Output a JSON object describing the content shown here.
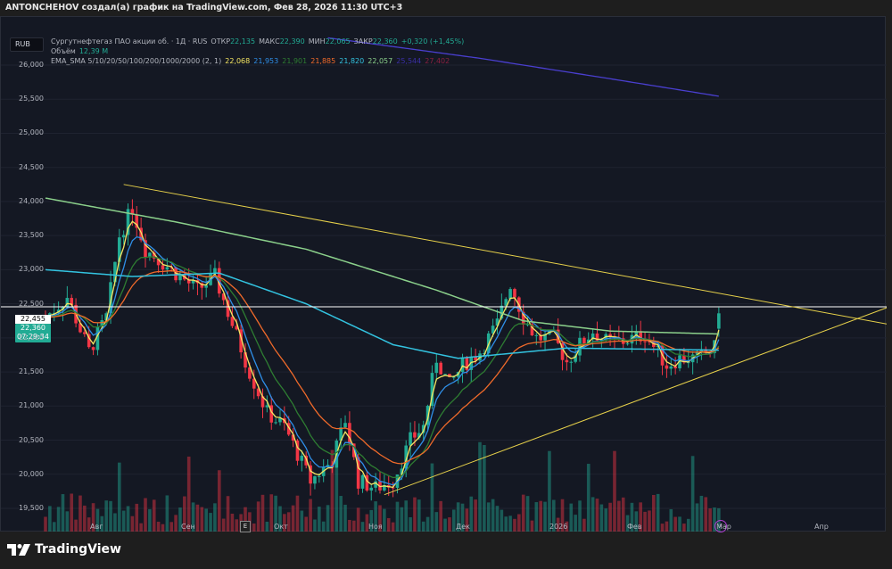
{
  "header": {
    "title": "ANTONCHEHOV создал(а) график на TradingView.com, Фев 28, 2026 11:30 UTC+3"
  },
  "currency": "RUB",
  "legend": {
    "symbol": "Сургутнефтегаз ПАО акции об. · 1Д · RUS",
    "open_label": "ОТКР",
    "open": "22,135",
    "high_label": "МАКС",
    "high": "22,390",
    "low_label": "МИН",
    "low": "22,065",
    "close_label": "ЗАКР",
    "close": "22,360",
    "change": "+0,320 (+1,45%)",
    "volume_label": "Объём",
    "volume": "12,39 M",
    "indicator": "EMA_SMA 5/10/20/50/100/200/1000/2000 (2, 1)",
    "ma_values": [
      {
        "v": "22,068",
        "color": "#f5e663"
      },
      {
        "v": "21,953",
        "color": "#2f8fe8"
      },
      {
        "v": "21,901",
        "color": "#2e7d32"
      },
      {
        "v": "21,885",
        "color": "#f06a2a"
      },
      {
        "v": "21,820",
        "color": "#33c3e0"
      },
      {
        "v": "22,057",
        "color": "#8bd08b"
      },
      {
        "v": "25,544",
        "color": "#3b2fa8"
      },
      {
        "v": "27,402",
        "color": "#8a2040"
      }
    ]
  },
  "price_axis": [
    "26,000",
    "25,500",
    "25,000",
    "24,500",
    "24,000",
    "23,500",
    "23,000",
    "22,500",
    "22,000",
    "21,500",
    "21,000",
    "20,500",
    "20,000",
    "19,500"
  ],
  "price_labels": {
    "line": "22,455",
    "last": "22,360",
    "countdown": "07:29:34"
  },
  "time_axis": [
    "Авг",
    "Сен",
    "Окт",
    "Ноя",
    "Дек",
    "2026",
    "Фев",
    "Мар",
    "Апр"
  ],
  "buttons": {
    "e": "E",
    "p": "⚡"
  },
  "brand": "TradingView",
  "colors": {
    "up": "#22ab94",
    "down": "#f23645",
    "hline": "#ffffff",
    "trend": "#e6d04a"
  },
  "chart_data": {
    "type": "candlestick",
    "ylim": [
      19500,
      26000
    ],
    "price_path": [
      [
        0,
        22300
      ],
      [
        5,
        22600
      ],
      [
        10,
        21800
      ],
      [
        14,
        22300
      ],
      [
        17,
        23500
      ],
      [
        20,
        23900
      ],
      [
        23,
        23300
      ],
      [
        27,
        23100
      ],
      [
        31,
        22900
      ],
      [
        35,
        22700
      ],
      [
        39,
        22900
      ],
      [
        43,
        22200
      ],
      [
        47,
        21500
      ],
      [
        51,
        20900
      ],
      [
        55,
        20700
      ],
      [
        58,
        20300
      ],
      [
        61,
        19900
      ],
      [
        66,
        20200
      ],
      [
        69,
        20800
      ],
      [
        72,
        19900
      ],
      [
        76,
        19800
      ],
      [
        80,
        19900
      ],
      [
        84,
        20500
      ],
      [
        87,
        20700
      ],
      [
        90,
        21700
      ],
      [
        93,
        21300
      ],
      [
        96,
        21600
      ],
      [
        100,
        21800
      ],
      [
        104,
        22200
      ],
      [
        107,
        22800
      ],
      [
        110,
        22300
      ],
      [
        113,
        22000
      ],
      [
        117,
        22000
      ],
      [
        120,
        21650
      ],
      [
        123,
        21900
      ],
      [
        126,
        22100
      ],
      [
        129,
        21950
      ],
      [
        133,
        21950
      ],
      [
        138,
        22050
      ],
      [
        143,
        21600
      ],
      [
        146,
        21700
      ],
      [
        150,
        21700
      ],
      [
        154,
        21850
      ],
      [
        155,
        22360
      ]
    ],
    "ma200": [
      [
        0,
        24050
      ],
      [
        30,
        23700
      ],
      [
        60,
        23300
      ],
      [
        90,
        22700
      ],
      [
        110,
        22250
      ],
      [
        130,
        22100
      ],
      [
        155,
        22057
      ]
    ],
    "ma100": [
      [
        0,
        23000
      ],
      [
        20,
        22900
      ],
      [
        40,
        22950
      ],
      [
        60,
        22500
      ],
      [
        80,
        21900
      ],
      [
        95,
        21700
      ],
      [
        120,
        21850
      ],
      [
        155,
        21820
      ]
    ],
    "ma1000": [
      [
        65,
        26400
      ],
      [
        100,
        26100
      ],
      [
        130,
        25800
      ],
      [
        155,
        25544
      ]
    ],
    "horizontal_line": 22455,
    "trendlines": [
      [
        [
          18,
          24250
        ],
        [
          194,
          22200
        ]
      ],
      [
        [
          78,
          19700
        ],
        [
          194,
          22450
        ]
      ]
    ]
  }
}
